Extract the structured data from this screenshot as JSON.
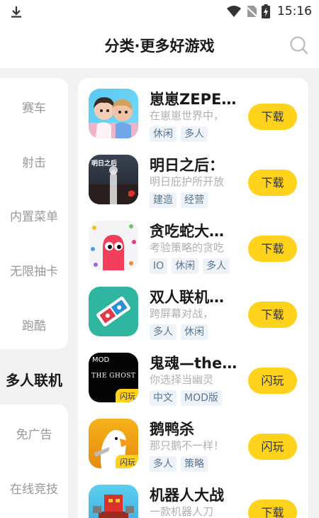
{
  "status_bar": {
    "time": "15:16"
  },
  "header": {
    "title": "分类·更多好游戏"
  },
  "sidebar": {
    "items": [
      "赛车",
      "射击",
      "内置菜单",
      "无限抽卡",
      "跑酷",
      "多人联机",
      "免广告",
      "在线竞技"
    ],
    "active": "多人联机"
  },
  "games": [
    {
      "name": "崽崽ZEPETO",
      "desc": "在崽崽世界中，",
      "tags": [
        "休闲",
        "多人"
      ],
      "action": "下载",
      "badge": ""
    },
    {
      "name": "明日之后：",
      "desc": "明日庇护所开放",
      "tags": [
        "建造",
        "经营"
      ],
      "action": "下载",
      "badge": ""
    },
    {
      "name": "贪吃蛇大作战",
      "desc": "考验策略的贪吃",
      "tags": [
        "IO",
        "休闲",
        "多人"
      ],
      "action": "下载",
      "badge": ""
    },
    {
      "name": "双人联机游戏",
      "desc": "跨屏幕对战，",
      "tags": [
        "多人",
        "休闲"
      ],
      "action": "下载",
      "badge": ""
    },
    {
      "name": "鬼魂—the ghost",
      "desc": "你选择当幽灵",
      "tags": [
        "中文",
        "MOD版"
      ],
      "action": "闪玩",
      "badge": "闪玩"
    },
    {
      "name": "鹅鸭杀",
      "desc": "那只鹅不一样！",
      "tags": [
        "多人",
        "策略"
      ],
      "action": "闪玩",
      "badge": "闪玩"
    },
    {
      "name": "机器人大战",
      "desc": "一款机器人刀",
      "tags": [],
      "action": "下载",
      "badge": ""
    }
  ],
  "icon_texts": {
    "mod_label": "MOD",
    "ghost_logo": "THE GHOST",
    "mingri_label": "明日之后"
  },
  "colors": {
    "accent": "#ffd21c",
    "tag_bg": "#eef3fa",
    "tag_text": "#5a7590"
  }
}
